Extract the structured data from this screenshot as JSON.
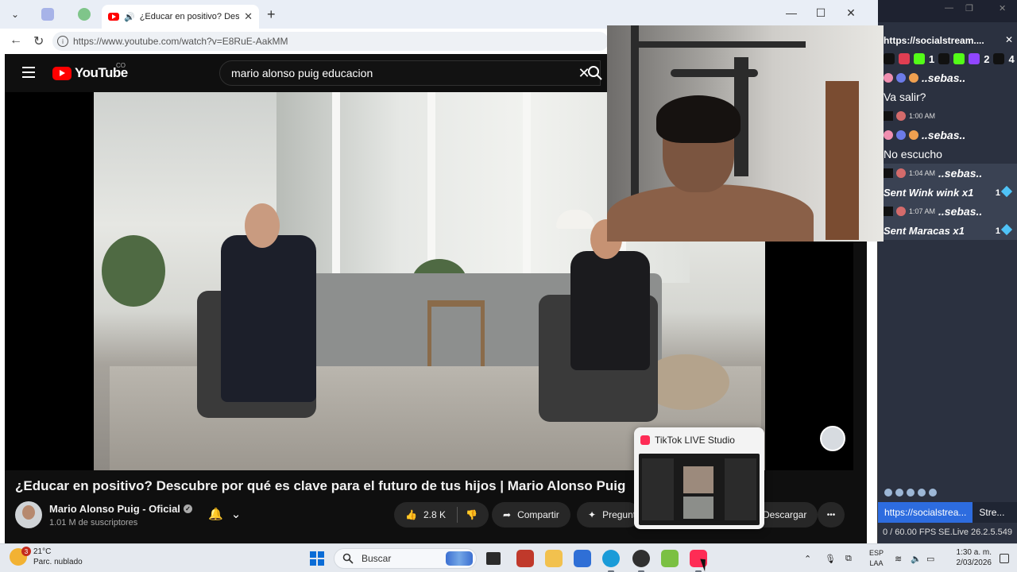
{
  "browser": {
    "active_tab_title": "¿Educar en positivo? Descubre por qué es clave para el futuro de tus hijos",
    "new_tab_symbol": "+",
    "url": "https://www.youtube.com/watch?v=E8RuE-AakMM",
    "window_controls": {
      "minimize": "—",
      "maximize": "☐",
      "close": "✕"
    }
  },
  "youtube": {
    "logo_text": "YouTube",
    "country_code": "CO",
    "search_query": "mario alonso puig educacion",
    "video_title": "¿Educar en positivo? Descubre por qué es clave para el futuro de tus hijos | Mario Alonso Puig",
    "channel_name": "Mario Alonso Puig - Oficial",
    "subscribers": "1.01 M de suscriptores",
    "likes": "2.8 K",
    "share_label": "Compartir",
    "ask_label": "Pregunt",
    "download_label": "Descargar",
    "more_label": "•••"
  },
  "socialstream": {
    "title": "https://socialstream....",
    "close": "✕",
    "counts": [
      {
        "platform": "tiktok",
        "value": "1"
      },
      {
        "platform": "kick",
        "value": ""
      },
      {
        "platform": "twitch",
        "value": "2"
      },
      {
        "platform": "tiktok",
        "value": "4"
      }
    ],
    "chat": [
      {
        "type": "name",
        "text": "..sebas.."
      },
      {
        "type": "msg",
        "text": "Va salir?"
      },
      {
        "type": "time",
        "time": "1:00 AM"
      },
      {
        "type": "name",
        "text": "..sebas.."
      },
      {
        "type": "msg",
        "text": "No escucho"
      },
      {
        "type": "event",
        "time": "1:04 AM",
        "user": "..sebas.."
      },
      {
        "type": "gift",
        "text": "Sent Wink wink x1",
        "amount": "1"
      },
      {
        "type": "event",
        "time": "1:07 AM",
        "user": "..sebas.."
      },
      {
        "type": "gift",
        "text": "Sent Maracas x1",
        "amount": "1"
      }
    ],
    "tabs": [
      "https://socialstrea...",
      "Stre..."
    ],
    "fps": "0 / 60.00 FPS",
    "version": "SE.Live 26.2.5.549"
  },
  "tiktok_preview": {
    "title": "TikTok LIVE Studio"
  },
  "taskbar": {
    "weather_badge": "3",
    "temperature": "21°C",
    "condition": "Parc. nublado",
    "search_placeholder": "Buscar",
    "language": "ESP",
    "layout": "LAA",
    "time": "1:30 a. m.",
    "date": "2/03/2026"
  },
  "colors": {
    "youtube_red": "#ff0000",
    "tiktok_pink": "#fe2c55",
    "twitch_purple": "#9146ff",
    "kick_green": "#53fc18"
  }
}
